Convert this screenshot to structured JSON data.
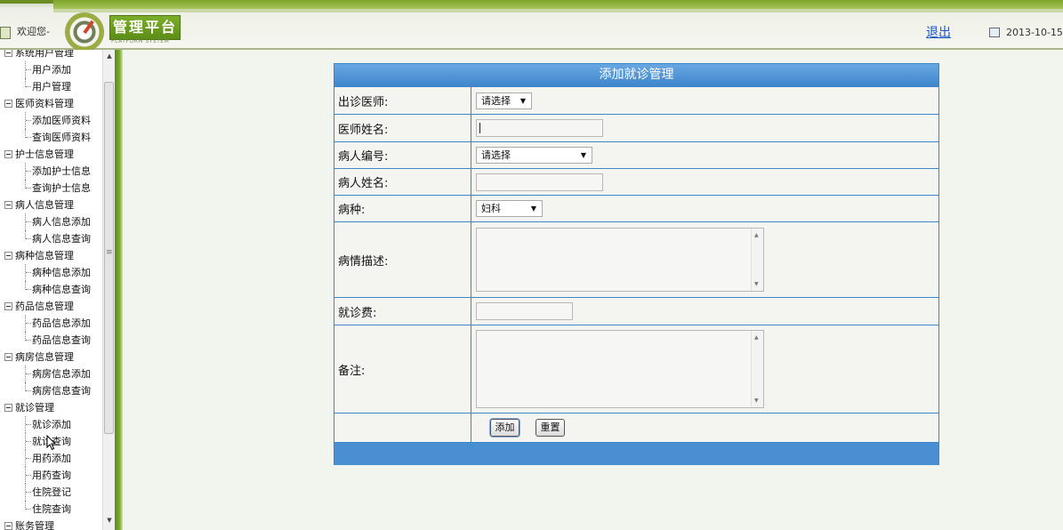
{
  "header": {
    "welcome": "欢迎您-",
    "logo_text": "管理平台",
    "logo_sub": "PLATFORM SYSTEM",
    "logout": "退出",
    "date": "2013-10-15"
  },
  "sidebar": {
    "items": [
      {
        "label": "系统用户管理",
        "level": 0
      },
      {
        "label": "用户添加",
        "level": 1
      },
      {
        "label": "用户管理",
        "level": 1
      },
      {
        "label": "医师资料管理",
        "level": 0
      },
      {
        "label": "添加医师资料",
        "level": 1
      },
      {
        "label": "查询医师资料",
        "level": 1
      },
      {
        "label": "护士信息管理",
        "level": 0
      },
      {
        "label": "添加护士信息",
        "level": 1
      },
      {
        "label": "查询护士信息",
        "level": 1
      },
      {
        "label": "病人信息管理",
        "level": 0
      },
      {
        "label": "病人信息添加",
        "level": 1
      },
      {
        "label": "病人信息查询",
        "level": 1
      },
      {
        "label": "病种信息管理",
        "level": 0
      },
      {
        "label": "病种信息添加",
        "level": 1
      },
      {
        "label": "病种信息查询",
        "level": 1
      },
      {
        "label": "药品信息管理",
        "level": 0
      },
      {
        "label": "药品信息添加",
        "level": 1
      },
      {
        "label": "药品信息查询",
        "level": 1
      },
      {
        "label": "病房信息管理",
        "level": 0
      },
      {
        "label": "病房信息添加",
        "level": 1
      },
      {
        "label": "病房信息查询",
        "level": 1
      },
      {
        "label": "就诊管理",
        "level": 0
      },
      {
        "label": "就诊添加",
        "level": 1
      },
      {
        "label": "就诊查询",
        "level": 1
      },
      {
        "label": "用药添加",
        "level": 1
      },
      {
        "label": "用药查询",
        "level": 1
      },
      {
        "label": "住院登记",
        "level": 1
      },
      {
        "label": "住院查询",
        "level": 1
      },
      {
        "label": "账务管理",
        "level": 0
      }
    ]
  },
  "form": {
    "title": "添加就诊管理",
    "doctor_label": "出诊医师:",
    "doctor_selected": "请选择",
    "doctor_name_label": "医师姓名:",
    "doctor_name_value": "",
    "patient_id_label": "病人编号:",
    "patient_id_selected": "请选择",
    "patient_name_label": "病人姓名:",
    "patient_name_value": "",
    "disease_label": "病种:",
    "disease_selected": "妇科",
    "description_label": "病情描述:",
    "description_value": "",
    "fee_label": "就诊费:",
    "fee_value": "",
    "remark_label": "备注:",
    "remark_value": "",
    "add_button": "添加",
    "reset_button": "重置"
  },
  "colors": {
    "accent_green": "#6b8d22",
    "form_blue": "#3f86c8",
    "link_blue": "#1a57c8"
  }
}
